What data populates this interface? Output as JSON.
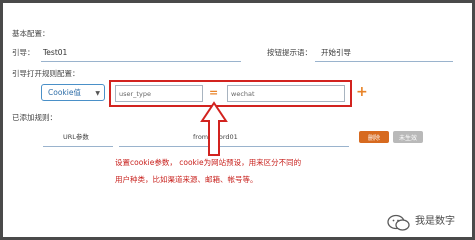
{
  "form": {
    "section_title": "基本配置：",
    "guide_label": "引导：",
    "guide_value": "Test01",
    "button_tip_label": "按钮提示语：",
    "button_tip_value": "开始引导",
    "rules_label": "引导打开规则配置：",
    "rule_type": "Cookie值",
    "rule_key": "user_type",
    "equals_sign": "=",
    "rule_value": "wechat",
    "add_icon": "plus-icon"
  },
  "added_rules": {
    "label": "已添加规则：",
    "param_label": "URL参数",
    "param_value": "from=word01",
    "delete_label": "删除",
    "disabled_label": "未生效"
  },
  "annotation": {
    "line1": "设置cookie参数， cookie为网站预设，用来区分不同的",
    "line2": "用户种类，比如渠道来源、邮箱、帐号等。"
  },
  "watermark": {
    "text": "我是数字",
    "logo": "wechat-logo"
  },
  "colors": {
    "highlight_red": "#d2231f",
    "accent_orange": "#e8842a",
    "delete_button": "#d76a1f",
    "disabled_button": "#b9b9b9",
    "link_blue": "#2f6ea8"
  }
}
